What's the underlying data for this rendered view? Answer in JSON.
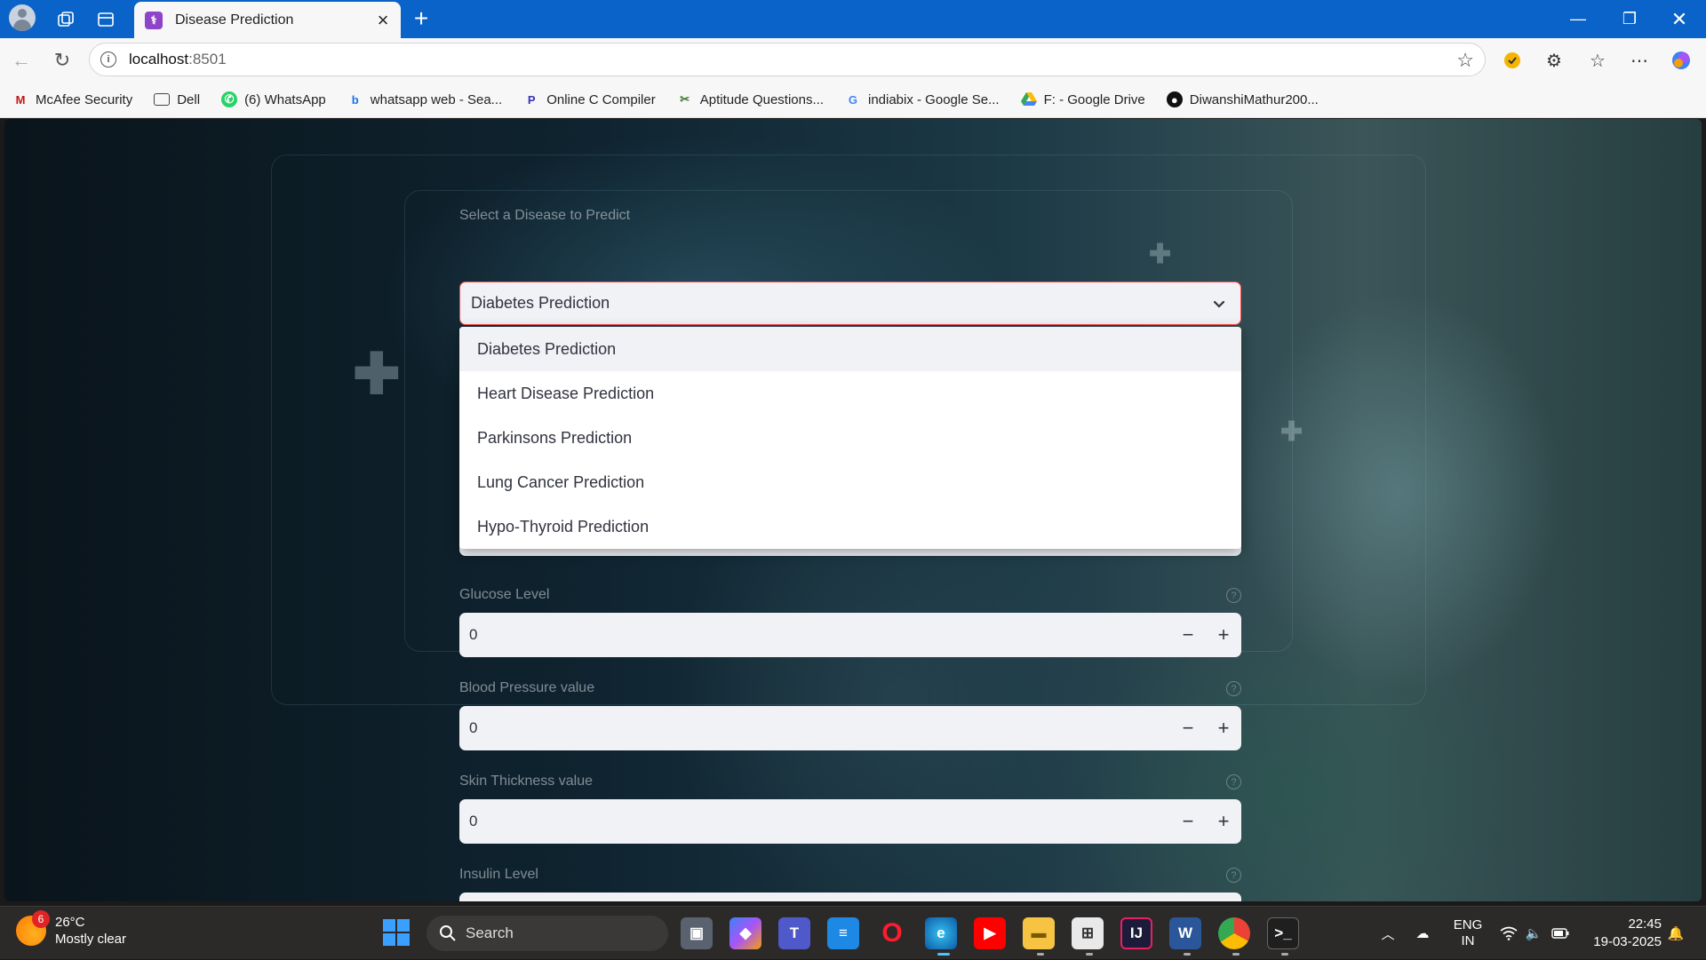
{
  "browser": {
    "tab_title": "Disease Prediction",
    "url_host": "localhost",
    "url_port": ":8501",
    "accent": "#0a63c9"
  },
  "bookmarks": [
    {
      "label": "McAfee Security",
      "icon": "mcafee-icon"
    },
    {
      "label": "Dell",
      "icon": "folder-icon"
    },
    {
      "label": "(6) WhatsApp",
      "icon": "whatsapp-icon"
    },
    {
      "label": "whatsapp web - Sea...",
      "icon": "bing-icon"
    },
    {
      "label": "Online C Compiler",
      "icon": "programiz-icon"
    },
    {
      "label": "Aptitude Questions...",
      "icon": "indiabix-icon"
    },
    {
      "label": "indiabix - Google Se...",
      "icon": "google-icon"
    },
    {
      "label": "F: - Google Drive",
      "icon": "google-drive-icon"
    },
    {
      "label": "DiwanshiMathur200...",
      "icon": "github-icon"
    }
  ],
  "app": {
    "select_label": "Select a Disease to Predict",
    "selected_value": "Diabetes Prediction",
    "options": [
      "Diabetes Prediction",
      "Heart Disease Prediction",
      "Parkinsons Prediction",
      "Lung Cancer Prediction",
      "Hypo-Thyroid Prediction"
    ],
    "fields": [
      {
        "label": "Glucose Level",
        "value": "0"
      },
      {
        "label": "Blood Pressure value",
        "value": "0"
      },
      {
        "label": "Skin Thickness value",
        "value": "0"
      },
      {
        "label": "Insulin Level",
        "value": ""
      }
    ],
    "select_border_color": "#ff4b4b"
  },
  "taskbar": {
    "weather_temp": "26°C",
    "weather_desc": "Mostly clear",
    "weather_badge": "6",
    "search_placeholder": "Search",
    "lang_top": "ENG",
    "lang_bottom": "IN",
    "time": "22:45",
    "date": "19-03-2025"
  }
}
